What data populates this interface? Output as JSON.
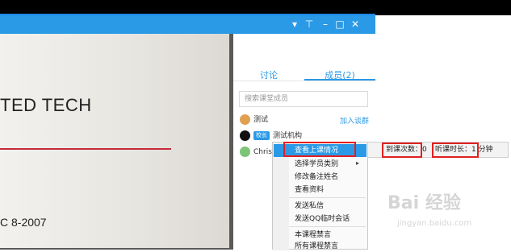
{
  "slide": {
    "title": "TED TECH",
    "standard": "C 8-2007"
  },
  "titlebar": {
    "icons": [
      "dropdown-icon",
      "pin-icon",
      "minimize-icon",
      "maximize-icon",
      "close-icon"
    ]
  },
  "panel": {
    "tabs": [
      "讨论",
      "成员(2)"
    ],
    "search_placeholder": "搜索课堂成员",
    "join_label": "加入谈群",
    "members": [
      {
        "name": "测试",
        "badge": ""
      },
      {
        "name": "测试机构",
        "badge": "校长"
      },
      {
        "name": "Chrisvv",
        "badge": ""
      }
    ]
  },
  "context_menu": {
    "items": [
      "查看上课情况",
      "选择学员类别",
      "修改备注姓名",
      "查看资料",
      "发送私信",
      "发送QQ临时会话",
      "本课程禁言",
      "所有课程禁言"
    ]
  },
  "submenu": {
    "attendance": "到课次数：0",
    "duration": "听课时长：1 分钟"
  },
  "watermark": {
    "brand": "Bai 经验",
    "url": "jingyan.baidu.com"
  },
  "colors": {
    "accent": "#2b9ae6",
    "highlight_box": "#e02020",
    "slide_rule": "#c62a3a"
  }
}
